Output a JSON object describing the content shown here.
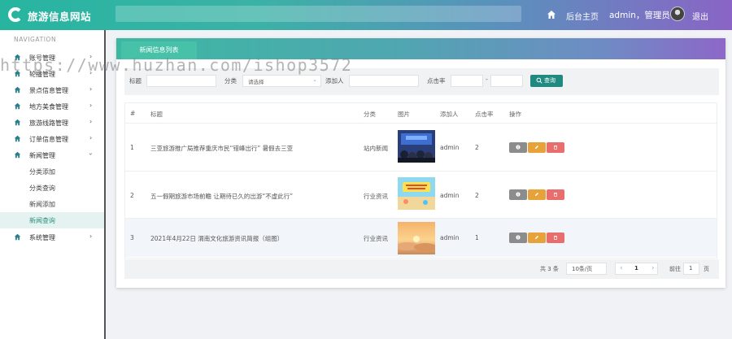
{
  "header": {
    "app_title": "旅游信息网站",
    "home_label": "后台主页",
    "user_label": "admin，管理员",
    "logout_label": "退出"
  },
  "watermark": "https://www.huzhan.com/ishop3572",
  "sidebar": {
    "heading": "NAVIGATION",
    "items": [
      {
        "label": "账号管理"
      },
      {
        "label": "轮播管理"
      },
      {
        "label": "景点信息管理"
      },
      {
        "label": "地方美食管理"
      },
      {
        "label": "旅游线路管理"
      },
      {
        "label": "订单信息管理"
      },
      {
        "label": "新闻管理"
      },
      {
        "label": "系统管理"
      }
    ],
    "sub_items": [
      {
        "label": "分类添加"
      },
      {
        "label": "分类查询"
      },
      {
        "label": "新闻添加"
      },
      {
        "label": "新闻查询"
      }
    ]
  },
  "panel": {
    "tab_label": "新闻信息列表"
  },
  "filters": {
    "title_label": "标题",
    "category_label": "分类",
    "category_placeholder": "请选择",
    "adder_label": "添加人",
    "clicks_label": "点击率",
    "range_dash": "-",
    "search_button": "查询"
  },
  "table": {
    "headers": [
      "#",
      "标题",
      "分类",
      "图片",
      "添加人",
      "点击率",
      "操作"
    ],
    "rows": [
      {
        "index": "1",
        "title": "三亚旅游推广局推荐重庆市民“错峰出行” 暑假去三亚",
        "category": "站内新闻",
        "image": "crowd-stage-photo",
        "adder": "admin",
        "clicks": "2"
      },
      {
        "index": "2",
        "title": "五一假期旅游市场前瞻 让期待已久的出游“不虚此行”",
        "category": "行业资讯",
        "image": "beach-cartoon-poster",
        "adder": "admin",
        "clicks": "2"
      },
      {
        "index": "3",
        "title": "2021年4月22日 渭南文化旅游资讯简报（组图）",
        "category": "行业资讯",
        "image": "sunset-clouds-photo",
        "adder": "admin",
        "clicks": "1"
      }
    ]
  },
  "pagination": {
    "total": "共 3 条",
    "page_size": "10条/页",
    "prev": "‹",
    "current_page": "1",
    "next": "›",
    "goto_label": "前往",
    "goto_value": "1",
    "page_unit": "页"
  },
  "colors": {
    "info_button": "#8c8c8c",
    "edit_button": "#e8a23a",
    "delete_button": "#e96d6d",
    "accent": "#1f8a7f"
  },
  "icons": {
    "logo": "circle-logo-icon",
    "home": "home-icon",
    "menu": "home-icon",
    "search": "search-icon",
    "info": "info-icon",
    "edit": "edit-icon",
    "delete": "trash-icon"
  }
}
